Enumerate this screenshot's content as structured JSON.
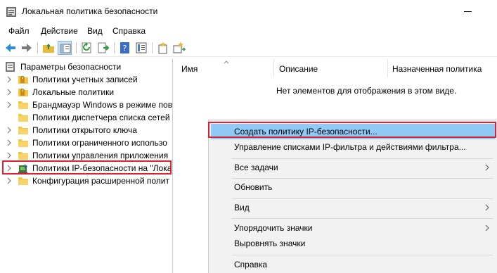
{
  "window": {
    "title": "Локальная политика безопасности"
  },
  "menu": [
    "Файл",
    "Действие",
    "Вид",
    "Справка"
  ],
  "tree": {
    "root": "Параметры безопасности",
    "items": [
      {
        "label": "Политики учетных записей",
        "icon": "locked-folder-icon"
      },
      {
        "label": "Локальные политики",
        "icon": "locked-folder-icon"
      },
      {
        "label": "Брандмауэр Windows в режиме пов",
        "icon": "folder-icon"
      },
      {
        "label": "Политики диспетчера списка сетей",
        "icon": "folder-icon"
      },
      {
        "label": "Политики открытого ключа",
        "icon": "folder-icon"
      },
      {
        "label": "Политики ограниченного использо",
        "icon": "folder-icon"
      },
      {
        "label": "Политики управления приложения",
        "icon": "folder-icon"
      },
      {
        "label": "Политики IP-безопасности на \"Лока",
        "icon": "ip-security-icon"
      },
      {
        "label": "Конфигурация расширенной полит",
        "icon": "folder-icon"
      }
    ]
  },
  "list": {
    "columns": [
      "Имя",
      "Описание",
      "Назначенная политика"
    ],
    "empty_message": "Нет элементов для отображения в этом виде."
  },
  "context_menu": {
    "items": [
      {
        "label": "Создать политику IP-безопасности...",
        "submenu": false
      },
      {
        "label": "Управление списками IP-фильтра и действиями фильтра...",
        "submenu": false
      },
      {
        "label": "Все задачи",
        "submenu": true
      },
      {
        "label": "Обновить",
        "submenu": false
      },
      {
        "label": "Вид",
        "submenu": true
      },
      {
        "label": "Упорядочить значки",
        "submenu": true
      },
      {
        "label": "Выровнять значки",
        "submenu": false
      },
      {
        "label": "Справка",
        "submenu": false
      }
    ]
  },
  "colors": {
    "highlight_border": "#e0202e",
    "menu_hover": "#91c9f7",
    "folder": "#f3c640"
  }
}
